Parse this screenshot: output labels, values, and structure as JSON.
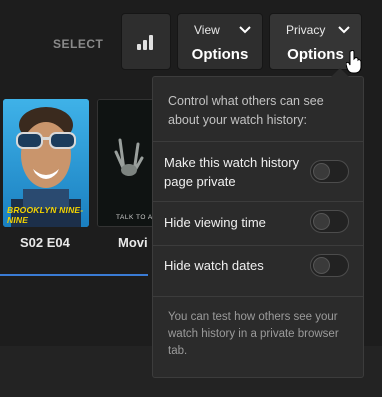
{
  "toolbar": {
    "select_label": "SELECT",
    "stats_icon": "bar-chart-icon",
    "view_button": {
      "small_label": "View",
      "main_label": "Options",
      "icon": "chevron-down-icon"
    },
    "privacy_button": {
      "small_label": "Privacy",
      "main_label": "Options",
      "icon": "chevron-down-icon"
    }
  },
  "posters": [
    {
      "title_art": "BROOKLYN NINE-NINE",
      "caption": "S02 E04"
    },
    {
      "title_art": "TALK TO A",
      "caption": "Movi"
    }
  ],
  "privacy_dropdown": {
    "intro": "Control what others can see about your watch history:",
    "options": [
      {
        "label": "Make this watch history page private",
        "enabled": false
      },
      {
        "label": "Hide viewing time",
        "enabled": false
      },
      {
        "label": "Hide watch dates",
        "enabled": false
      }
    ],
    "footer": "You can test how others see your watch history in a private browser tab."
  },
  "colors": {
    "background": "#1d1d1d",
    "panel": "#2b2b2b",
    "accent_line": "#3a7bd5",
    "poster_title": "#f5d400"
  }
}
